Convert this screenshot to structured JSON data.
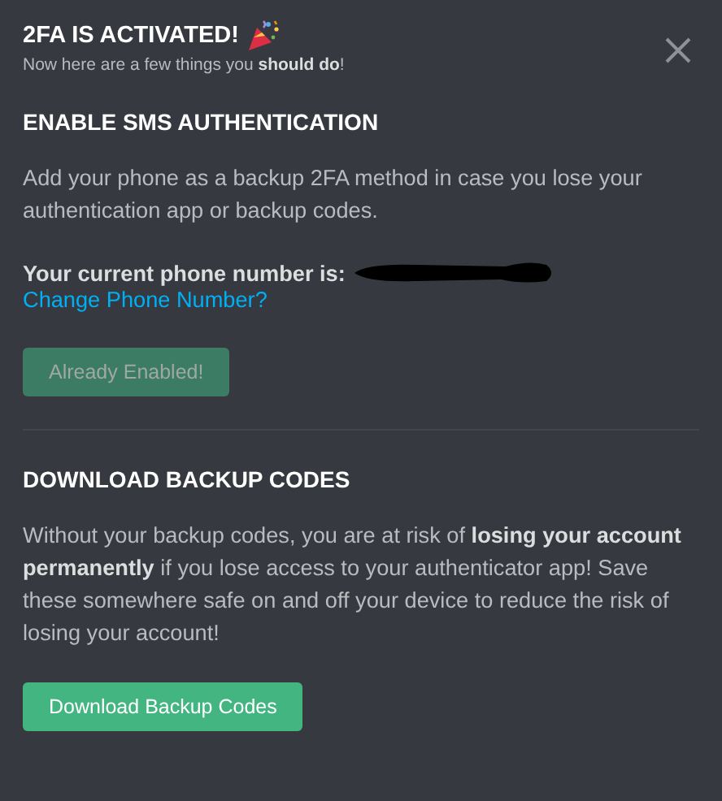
{
  "header": {
    "title": "2FA IS ACTIVATED!",
    "subtitle": "Now here are a few things you **should do**!"
  },
  "sms": {
    "heading": "ENABLE SMS AUTHENTICATION",
    "description": "Add your phone as a backup 2FA method in case you lose your authentication app or backup codes.",
    "phone_label": "Your current phone number is:",
    "change_link": "Change Phone Number?",
    "button": {
      "label": "Already Enabled!",
      "disabled": true
    }
  },
  "backup": {
    "heading": "DOWNLOAD BACKUP CODES",
    "description": "Without your backup codes, you are at risk of **losing your account permanently** if you lose access to your authenticator app! Save these somewhere safe on and off your device to reduce the risk of losing your account!",
    "button": {
      "label": "Download Backup Codes",
      "disabled": false
    }
  }
}
